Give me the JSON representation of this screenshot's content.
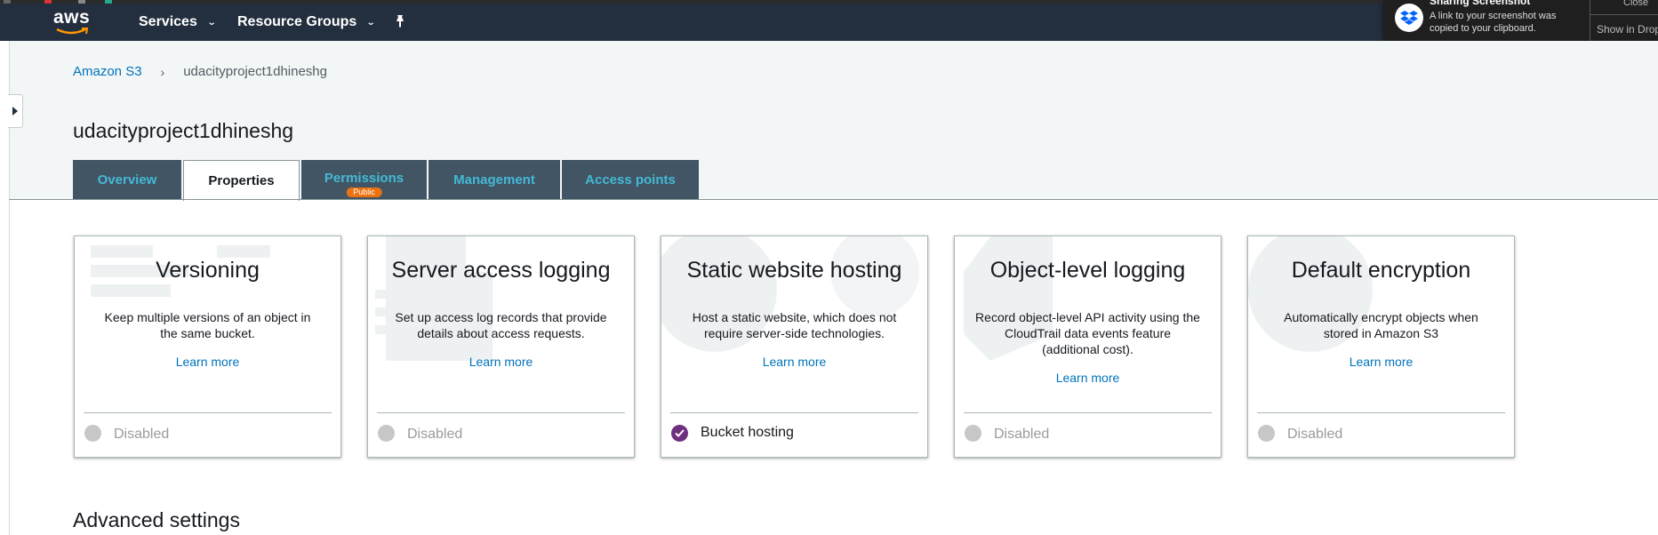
{
  "nav": {
    "services_label": "Services",
    "resource_groups_label": "Resource Groups",
    "logo_text": "aws"
  },
  "notification": {
    "title": "Sharing Screenshot",
    "body": "A link to your screenshot was copied to your clipboard.",
    "close_label": "Close",
    "show_label": "Show in Dropbox"
  },
  "breadcrumb": {
    "root": "Amazon S3",
    "separator": "›",
    "current": "udacityproject1dhineshg"
  },
  "bucket": {
    "title": "udacityproject1dhineshg"
  },
  "tabs": [
    {
      "label": "Overview",
      "active": false
    },
    {
      "label": "Properties",
      "active": true
    },
    {
      "label": "Permissions",
      "badge": "Public",
      "active": false
    },
    {
      "label": "Management",
      "active": false
    },
    {
      "label": "Access points",
      "active": false
    }
  ],
  "cards": [
    {
      "title": "Versioning",
      "description": "Keep multiple versions of an object in the same bucket.",
      "learn_more": "Learn more",
      "status": "Disabled",
      "enabled": false
    },
    {
      "title": "Server access logging",
      "description": "Set up access log records that provide details about access requests.",
      "learn_more": "Learn more",
      "status": "Disabled",
      "enabled": false
    },
    {
      "title": "Static website hosting",
      "description": "Host a static website, which does not require server-side technologies.",
      "learn_more": "Learn more",
      "status": "Bucket hosting",
      "enabled": true
    },
    {
      "title": "Object-level logging",
      "description": "Record object-level API activity using the CloudTrail data events feature (additional cost).",
      "learn_more": "Learn more",
      "status": "Disabled",
      "enabled": false
    },
    {
      "title": "Default encryption",
      "description": "Automatically encrypt objects when stored in Amazon S3",
      "learn_more": "Learn more",
      "status": "Disabled",
      "enabled": false
    }
  ],
  "advanced": {
    "title": "Advanced settings"
  },
  "colors": {
    "nav_bg": "#232f3e",
    "tab_bg": "#415564",
    "tab_text": "#44b9d6",
    "link": "#0073bb",
    "badge": "#ec7211",
    "enabled_check": "#6f2f7f",
    "disabled_dot": "#c7c7c7"
  }
}
